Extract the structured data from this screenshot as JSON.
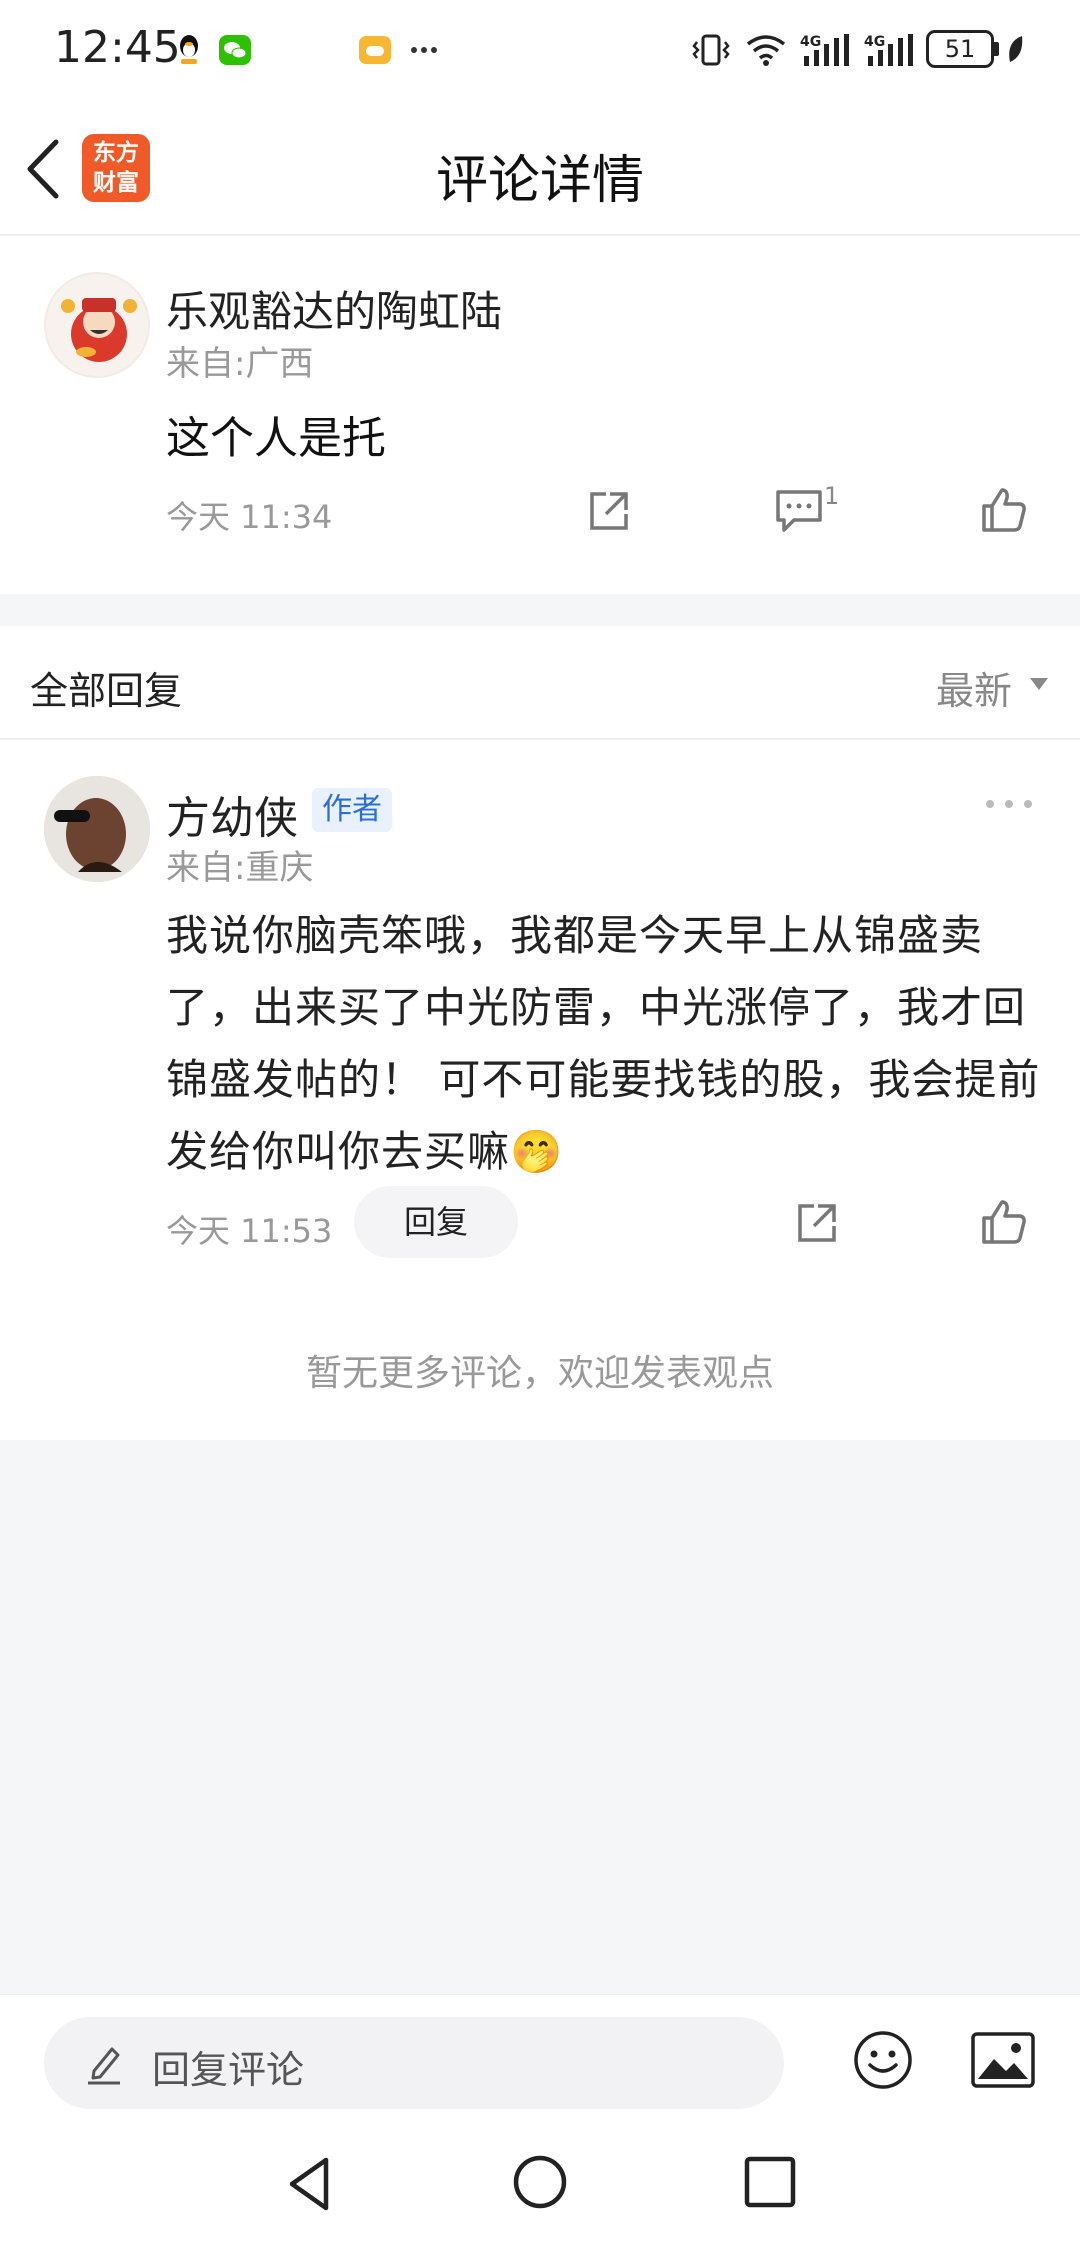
{
  "status_bar": {
    "time": "12:45",
    "icons": [
      "qq-icon",
      "wechat-icon",
      "game-icon",
      "more-dots-icon",
      "vibrate-icon",
      "wifi-icon",
      "signal-4g-icon",
      "signal-4g-icon",
      "battery-icon",
      "leaf-icon"
    ],
    "battery": "51"
  },
  "header": {
    "title": "评论详情",
    "app_logo_line1": "东方",
    "app_logo_line2": "财富"
  },
  "main_comment": {
    "username": "乐观豁达的陶虹陆",
    "location": "来自:广西",
    "text": "这个人是托",
    "time": "今天 11:34",
    "reply_count": "1"
  },
  "replies_section": {
    "title": "全部回复",
    "sort_label": "最新"
  },
  "reply": {
    "username": "方幼侠",
    "badge": "作者",
    "location": "来自:重庆",
    "text": "我说你脑壳笨哦，我都是今天早上从锦盛卖了，出来买了中光防雷，中光涨停了，我才回锦盛发帖的！ 可不可能要找钱的股，我会提前发给你叫你去买嘛",
    "emoji": "🤭",
    "time": "今天 11:53",
    "reply_button": "回复"
  },
  "no_more_text": "暂无更多评论，欢迎发表观点",
  "input_bar": {
    "placeholder": "回复评论"
  },
  "colors": {
    "brand_orange": "#f05a28",
    "badge_blue": "#2b6fd6",
    "badge_bg": "#e8f1fc",
    "background": "#f5f6f8"
  }
}
